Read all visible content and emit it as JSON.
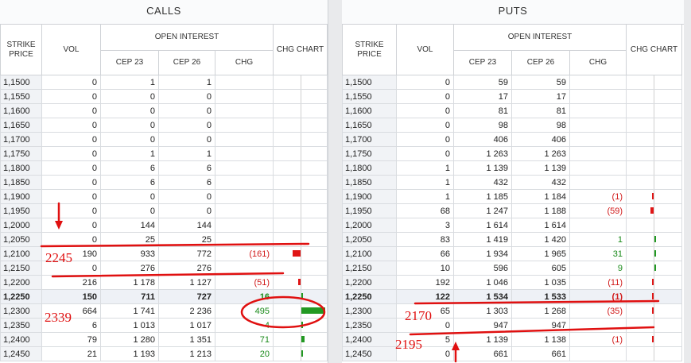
{
  "calls": {
    "title": "CALLS",
    "headers": {
      "strike": "STRIKE PRICE",
      "vol": "VOL",
      "oi": "OPEN INTEREST",
      "oi_a": "СЕР 23",
      "oi_b": "СЕР 26",
      "chg": "CHG",
      "chart": "CHG CHART"
    },
    "rows": [
      {
        "strike": "1,1500",
        "vol": "0",
        "a": "1",
        "b": "1",
        "chg": "",
        "bar": 0
      },
      {
        "strike": "1,1550",
        "vol": "0",
        "a": "0",
        "b": "0",
        "chg": "",
        "bar": 0
      },
      {
        "strike": "1,1600",
        "vol": "0",
        "a": "0",
        "b": "0",
        "chg": "",
        "bar": 0
      },
      {
        "strike": "1,1650",
        "vol": "0",
        "a": "0",
        "b": "0",
        "chg": "",
        "bar": 0
      },
      {
        "strike": "1,1700",
        "vol": "0",
        "a": "0",
        "b": "0",
        "chg": "",
        "bar": 0
      },
      {
        "strike": "1,1750",
        "vol": "0",
        "a": "1",
        "b": "1",
        "chg": "",
        "bar": 0
      },
      {
        "strike": "1,1800",
        "vol": "0",
        "a": "6",
        "b": "6",
        "chg": "",
        "bar": 0
      },
      {
        "strike": "1,1850",
        "vol": "0",
        "a": "6",
        "b": "6",
        "chg": "",
        "bar": 0
      },
      {
        "strike": "1,1900",
        "vol": "0",
        "a": "0",
        "b": "0",
        "chg": "",
        "bar": 0
      },
      {
        "strike": "1,1950",
        "vol": "0",
        "a": "0",
        "b": "0",
        "chg": "",
        "bar": 0
      },
      {
        "strike": "1,2000",
        "vol": "0",
        "a": "144",
        "b": "144",
        "chg": "",
        "bar": 0
      },
      {
        "strike": "1,2050",
        "vol": "0",
        "a": "25",
        "b": "25",
        "chg": "",
        "bar": 0
      },
      {
        "strike": "1,2100",
        "vol": "190",
        "a": "933",
        "b": "772",
        "chg": "(161)",
        "bar": -161
      },
      {
        "strike": "1,2150",
        "vol": "0",
        "a": "276",
        "b": "276",
        "chg": "",
        "bar": 0
      },
      {
        "strike": "1,2200",
        "vol": "216",
        "a": "1 178",
        "b": "1 127",
        "chg": "(51)",
        "bar": -51
      },
      {
        "strike": "1,2250",
        "vol": "150",
        "a": "711",
        "b": "727",
        "chg": "16",
        "bar": 16,
        "atm": true
      },
      {
        "strike": "1,2300",
        "vol": "664",
        "a": "1 741",
        "b": "2 236",
        "chg": "495",
        "bar": 495
      },
      {
        "strike": "1,2350",
        "vol": "6",
        "a": "1 013",
        "b": "1 017",
        "chg": "4",
        "bar": 4
      },
      {
        "strike": "1,2400",
        "vol": "79",
        "a": "1 280",
        "b": "1 351",
        "chg": "71",
        "bar": 71
      },
      {
        "strike": "1,2450",
        "vol": "21",
        "a": "1 193",
        "b": "1 213",
        "chg": "20",
        "bar": 20
      }
    ]
  },
  "puts": {
    "title": "PUTS",
    "headers": {
      "strike": "STRIKE PRICE",
      "vol": "VOL",
      "oi": "OPEN INTEREST",
      "oi_a": "СЕР 23",
      "oi_b": "СЕР 26",
      "chg": "CHG",
      "chart": "CHG CHART"
    },
    "rows": [
      {
        "strike": "1,1500",
        "vol": "0",
        "a": "59",
        "b": "59",
        "chg": "",
        "bar": 0
      },
      {
        "strike": "1,1550",
        "vol": "0",
        "a": "17",
        "b": "17",
        "chg": "",
        "bar": 0
      },
      {
        "strike": "1,1600",
        "vol": "0",
        "a": "81",
        "b": "81",
        "chg": "",
        "bar": 0
      },
      {
        "strike": "1,1650",
        "vol": "0",
        "a": "98",
        "b": "98",
        "chg": "",
        "bar": 0
      },
      {
        "strike": "1,1700",
        "vol": "0",
        "a": "406",
        "b": "406",
        "chg": "",
        "bar": 0
      },
      {
        "strike": "1,1750",
        "vol": "0",
        "a": "1 263",
        "b": "1 263",
        "chg": "",
        "bar": 0
      },
      {
        "strike": "1,1800",
        "vol": "1",
        "a": "1 139",
        "b": "1 139",
        "chg": "",
        "bar": 0
      },
      {
        "strike": "1,1850",
        "vol": "1",
        "a": "432",
        "b": "432",
        "chg": "",
        "bar": 0
      },
      {
        "strike": "1,1900",
        "vol": "1",
        "a": "1 185",
        "b": "1 184",
        "chg": "(1)",
        "bar": -1
      },
      {
        "strike": "1,1950",
        "vol": "68",
        "a": "1 247",
        "b": "1 188",
        "chg": "(59)",
        "bar": -59
      },
      {
        "strike": "1,2000",
        "vol": "3",
        "a": "1 614",
        "b": "1 614",
        "chg": "",
        "bar": 0
      },
      {
        "strike": "1,2050",
        "vol": "83",
        "a": "1 419",
        "b": "1 420",
        "chg": "1",
        "bar": 1
      },
      {
        "strike": "1,2100",
        "vol": "66",
        "a": "1 934",
        "b": "1 965",
        "chg": "31",
        "bar": 31
      },
      {
        "strike": "1,2150",
        "vol": "10",
        "a": "596",
        "b": "605",
        "chg": "9",
        "bar": 9
      },
      {
        "strike": "1,2200",
        "vol": "192",
        "a": "1 046",
        "b": "1 035",
        "chg": "(11)",
        "bar": -11
      },
      {
        "strike": "1,2250",
        "vol": "122",
        "a": "1 534",
        "b": "1 533",
        "chg": "(1)",
        "bar": -1,
        "atm": true
      },
      {
        "strike": "1,2300",
        "vol": "65",
        "a": "1 303",
        "b": "1 268",
        "chg": "(35)",
        "bar": -35
      },
      {
        "strike": "1,2350",
        "vol": "0",
        "a": "947",
        "b": "947",
        "chg": "",
        "bar": 0
      },
      {
        "strike": "1,2400",
        "vol": "5",
        "a": "1 139",
        "b": "1 138",
        "chg": "(1)",
        "bar": -1
      },
      {
        "strike": "1,2450",
        "vol": "0",
        "a": "661",
        "b": "661",
        "chg": "",
        "bar": 0
      }
    ]
  },
  "annotations": {
    "calls_upper": "2245",
    "calls_lower": "2339",
    "puts_upper": "2170",
    "puts_lower": "2195"
  },
  "colors": {
    "negative": "#d11919",
    "positive": "#1a8a1a",
    "annotation": "#e01010"
  }
}
